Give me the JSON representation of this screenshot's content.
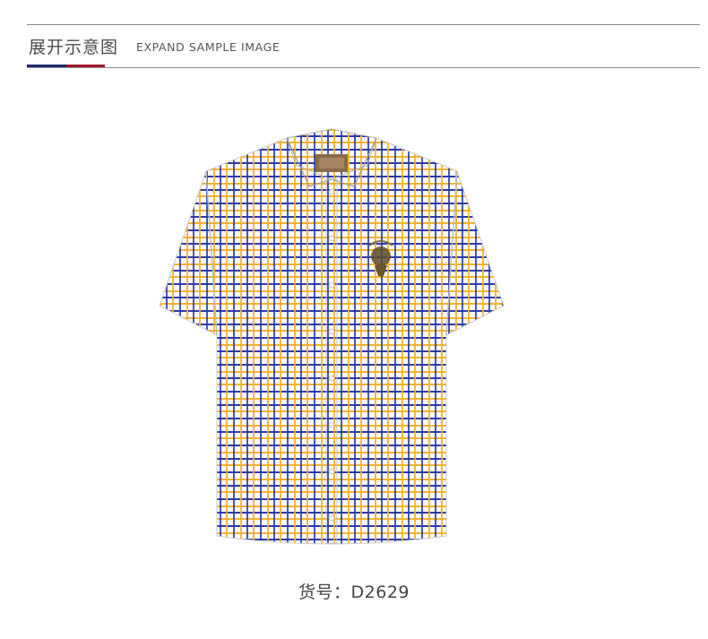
{
  "header": {
    "title_cn": "展开示意图",
    "title_en": "EXPAND SAMPLE IMAGE",
    "accent_colors": [
      "#1f2a6b",
      "#a3192e"
    ]
  },
  "product": {
    "image": "plaid-short-sleeve-shirt",
    "pattern_colors": [
      "#2b3aa6",
      "#f2b231",
      "#ffffff"
    ],
    "caption_label": "货号：",
    "caption_code": "D2629"
  }
}
